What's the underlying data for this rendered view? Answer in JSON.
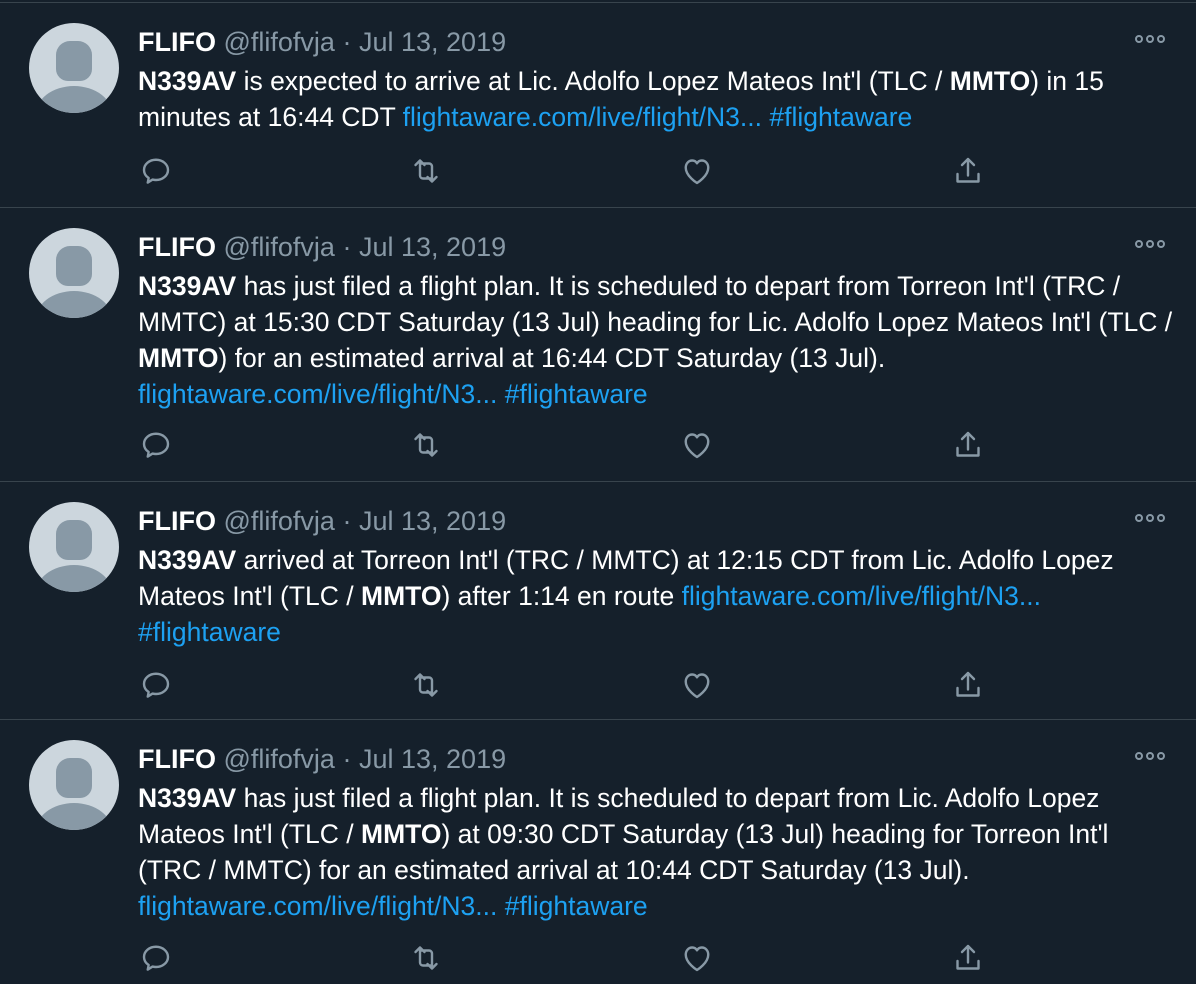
{
  "colors": {
    "background": "#15202b",
    "divider": "#38444d",
    "text": "#ffffff",
    "muted": "#8899a6",
    "link": "#1da1f2"
  },
  "icons": [
    "avatar-placeholder",
    "more-icon",
    "reply-icon",
    "retweet-icon",
    "like-icon",
    "share-icon"
  ],
  "tweets": [
    {
      "name": "FLIFO",
      "handle": "@flifofvja",
      "dot": "·",
      "date": "Jul 13, 2019",
      "more": "ooo",
      "tail": "N339AV",
      "parts": [
        {
          "t": " is expected to arrive at Lic. Adolfo Lopez Mateos Int'l (TLC / "
        },
        {
          "b": "MMTO"
        },
        {
          "t": ") in 15 minutes at 16:44 CDT "
        }
      ],
      "link": "flightaware.com/live/flight/N3...",
      "hashtag": "#flightaware"
    },
    {
      "name": "FLIFO",
      "handle": "@flifofvja",
      "dot": "·",
      "date": "Jul 13, 2019",
      "more": "ooo",
      "tail": "N339AV",
      "parts": [
        {
          "t": " has just filed a flight plan.  It is scheduled to depart from Torreon Int'l (TRC / MMTC) at 15:30 CDT Saturday (13 Jul) heading for Lic. Adolfo Lopez Mateos Int'l (TLC / "
        },
        {
          "b": "MMTO"
        },
        {
          "t": ") for an estimated arrival at 16:44 CDT Saturday (13 Jul). "
        }
      ],
      "link": "flightaware.com/live/flight/N3...",
      "hashtag": "#flightaware"
    },
    {
      "name": "FLIFO",
      "handle": "@flifofvja",
      "dot": "·",
      "date": "Jul 13, 2019",
      "more": "ooo",
      "tail": "N339AV",
      "parts": [
        {
          "t": " arrived at Torreon Int'l (TRC / MMTC) at 12:15 CDT from Lic. Adolfo Lopez Mateos Int'l (TLC / "
        },
        {
          "b": "MMTO"
        },
        {
          "t": ") after 1:14 en route "
        }
      ],
      "link": "flightaware.com/live/flight/N3...",
      "hashtag": "#flightaware"
    },
    {
      "name": "FLIFO",
      "handle": "@flifofvja",
      "dot": "·",
      "date": "Jul 13, 2019",
      "more": "ooo",
      "tail": "N339AV",
      "parts": [
        {
          "t": " has just filed a flight plan.  It is scheduled to depart from Lic. Adolfo Lopez Mateos Int'l (TLC / "
        },
        {
          "b": "MMTO"
        },
        {
          "t": ") at 09:30 CDT Saturday (13 Jul) heading for Torreon Int'l (TRC / MMTC) for an estimated arrival at 10:44 CDT Saturday (13 Jul). "
        }
      ],
      "link": "flightaware.com/live/flight/N3...",
      "hashtag": "#flightaware"
    }
  ]
}
